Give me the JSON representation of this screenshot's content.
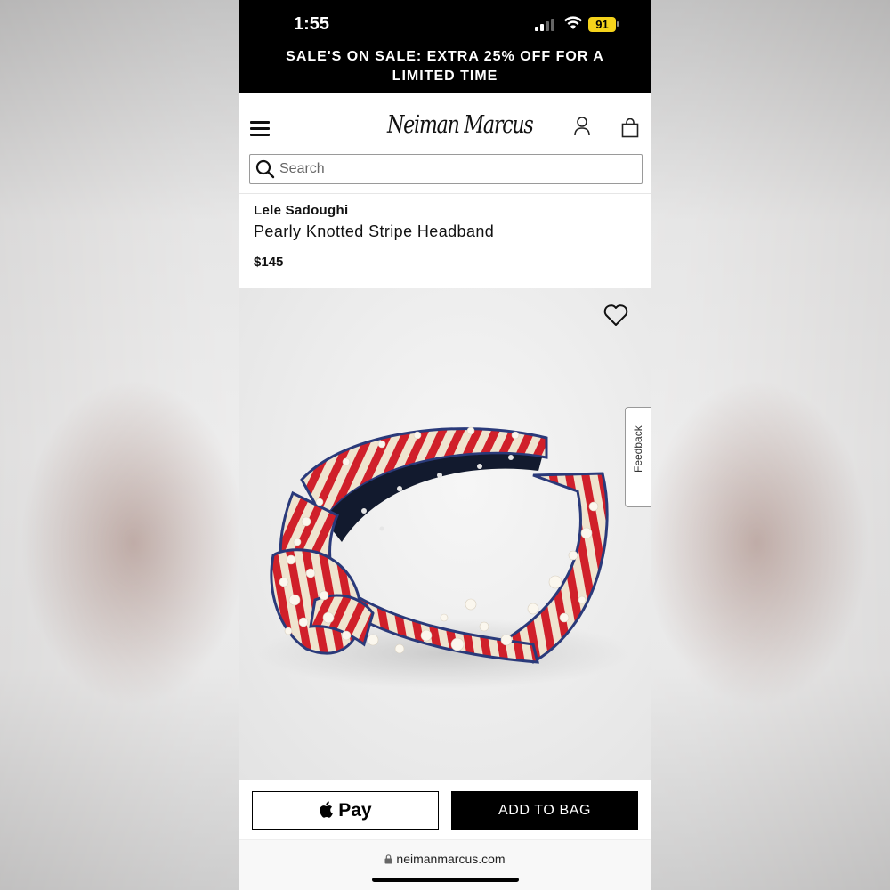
{
  "status_bar": {
    "time": "1:55",
    "battery_level": "91",
    "battery_color": "#f5d31b"
  },
  "promo_banner": {
    "text": "SALE'S ON SALE: EXTRA 25% OFF FOR A LIMITED TIME"
  },
  "header": {
    "logo": "Neiman Marcus",
    "icons": [
      "menu-icon",
      "account-icon",
      "shopping-bag-icon"
    ]
  },
  "search": {
    "placeholder": "Search",
    "value": ""
  },
  "product": {
    "brand": "Lele Sadoughi",
    "name": "Pearly Knotted Stripe Headband",
    "price": "$145"
  },
  "feedback": {
    "label": "Feedback"
  },
  "actions": {
    "apple_pay_label": "Pay",
    "add_to_bag_label": "ADD TO BAG"
  },
  "url_bar": {
    "url": "neimanmarcus.com"
  },
  "colors": {
    "brand_black": "#000000",
    "stripe_red": "#d0202a",
    "stripe_cream": "#efe4cf",
    "trim_navy": "#2a3a7a"
  }
}
